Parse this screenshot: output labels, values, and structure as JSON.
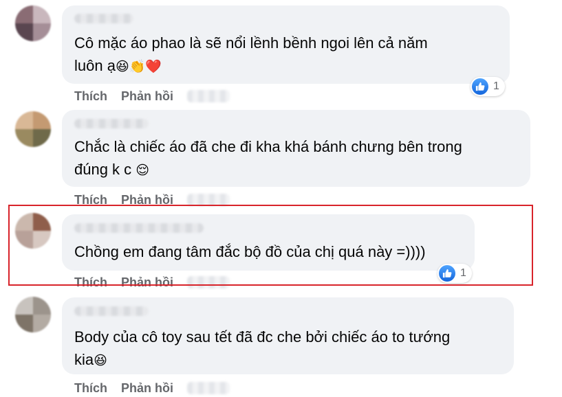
{
  "comments": [
    {
      "lines": [
        "Cô mặc áo phao là sẽ nổi lềnh bềnh ngoi lên cả năm",
        "luôn ạ"
      ],
      "emojis": "😆👏❤️",
      "actions": {
        "like": "Thích",
        "reply": "Phản hồi"
      },
      "reaction_count": "1"
    },
    {
      "lines": [
        "Chắc là chiếc áo đã che đi kha khá bánh chưng bên trong",
        "đúng k c"
      ],
      "emojis": "😌",
      "actions": {
        "like": "Thích",
        "reply": "Phản hồi"
      }
    },
    {
      "lines": [
        "Chồng em đang tâm đắc bộ đồ của chị quá này =))))"
      ],
      "actions": {
        "like": "Thích",
        "reply": "Phản hồi"
      },
      "reaction_count": "1",
      "highlighted": true
    },
    {
      "lines": [
        "Body của cô toy sau tết đã đc che bởi chiếc áo to tướng",
        "kia"
      ],
      "emojis": "😆",
      "actions": {
        "like": "Thích",
        "reply": "Phản hồi"
      }
    }
  ],
  "colors": {
    "bubble": "#f0f2f5",
    "action_text": "#65676b",
    "like_blue": "#1877f2",
    "highlight_border": "#d8232a"
  },
  "icons": {
    "reaction": "like-icon"
  }
}
